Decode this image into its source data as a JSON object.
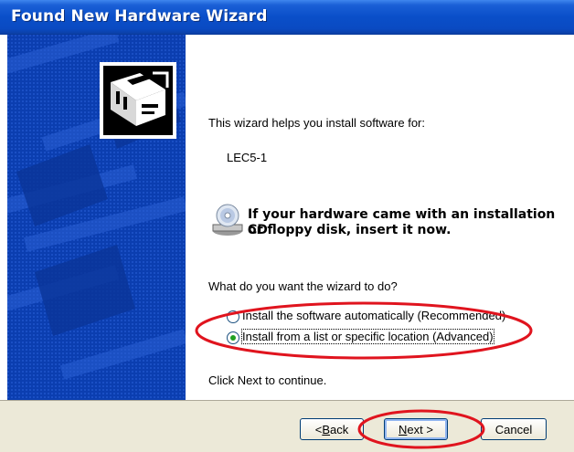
{
  "window": {
    "title": "Found New Hardware Wizard"
  },
  "content": {
    "intro": "This wizard helps you install software for:",
    "device": "LEC5-1",
    "cd_prompt_line1": "If your hardware came with an installation CD",
    "cd_prompt_line2": "or floppy disk, insert it now.",
    "question": "What do you want the wizard to do?",
    "options": [
      {
        "label": "Install the software automatically (Recommended)",
        "selected": false
      },
      {
        "label": "Install from a list or specific location (Advanced)",
        "selected": true
      }
    ],
    "footer_note": "Click Next to continue."
  },
  "buttons": {
    "back": {
      "prefix": "< ",
      "mnemonic": "B",
      "rest": "ack"
    },
    "next": {
      "mnemonic": "N",
      "rest": "ext >"
    },
    "cancel": "Cancel"
  },
  "icons": {
    "hardware": "hardware-wizard-icon",
    "cd": "cd-drive-icon"
  },
  "colors": {
    "titlebar": "#0a4fc9",
    "sidebar": "#0b3eb0",
    "footer": "#ece9d8",
    "annotation": "#e0141e"
  }
}
